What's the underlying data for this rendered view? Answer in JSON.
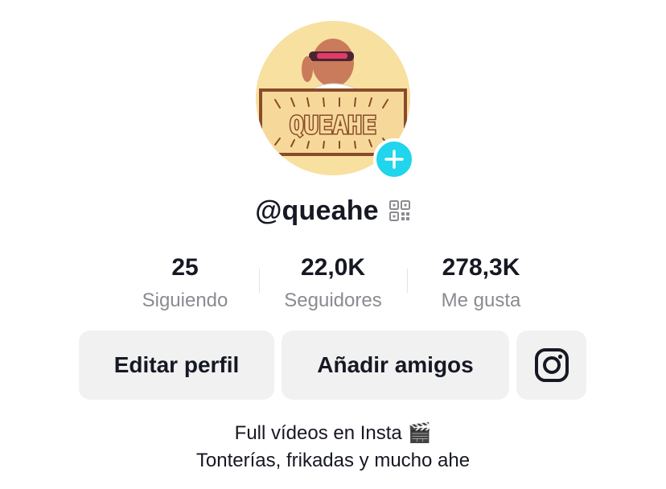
{
  "avatar": {
    "logo_text": "QUEAHE",
    "background_color": "#f8e0a0",
    "badge_color": "#20d5ec",
    "badge_icon": "plus-icon"
  },
  "profile": {
    "username": "@queahe",
    "qr_icon": "qr-code-icon"
  },
  "stats": [
    {
      "value": "25",
      "label": "Siguiendo"
    },
    {
      "value": "22,0K",
      "label": "Seguidores"
    },
    {
      "value": "278,3K",
      "label": "Me gusta"
    }
  ],
  "actions": {
    "edit_label": "Editar perfil",
    "add_friends_label": "Añadir amigos",
    "instagram_icon": "instagram-icon"
  },
  "bio": {
    "line1": "Full vídeos en Insta 🎬",
    "line2": "Tonterías, frikadas y mucho ahe"
  }
}
